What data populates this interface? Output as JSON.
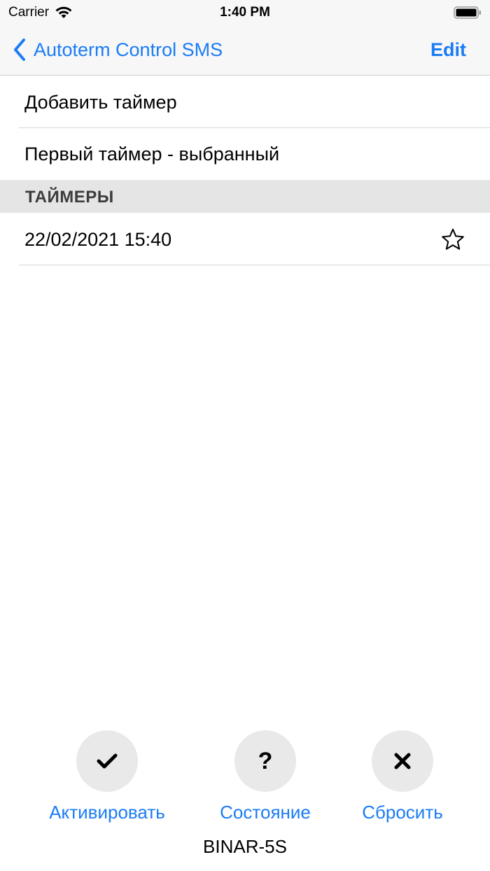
{
  "status": {
    "carrier": "Carrier",
    "time": "1:40 PM"
  },
  "nav": {
    "back_label": "Autoterm Control SMS",
    "edit_label": "Edit"
  },
  "rows": {
    "add_timer": "Добавить таймер",
    "first_timer": "Первый таймер - выбранный"
  },
  "section": {
    "title": "ТАЙМЕРЫ"
  },
  "timers": [
    {
      "datetime": "22/02/2021 15:40",
      "icon": "star-outline-icon"
    }
  ],
  "actions": {
    "activate": {
      "icon": "✔",
      "label": "Активировать"
    },
    "status": {
      "icon": "?",
      "label": "Состояние"
    },
    "reset": {
      "icon": "✖",
      "label": "Сбросить"
    }
  },
  "device_name": "BINAR-5S",
  "colors": {
    "accent": "#1a7cf5",
    "section_bg": "#e5e5e5",
    "circle_bg": "#e9e9e9"
  }
}
